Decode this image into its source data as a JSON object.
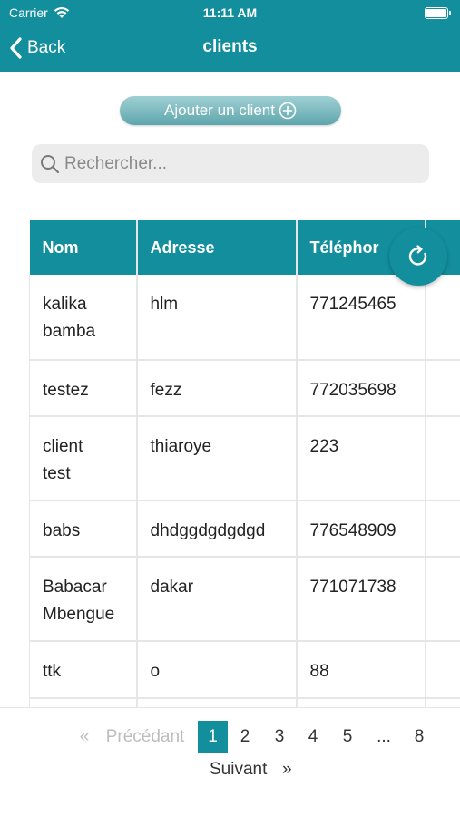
{
  "status_bar": {
    "carrier": "Carrier",
    "time": "11:11 AM"
  },
  "nav": {
    "back_label": "Back",
    "title": "clients"
  },
  "add_button": {
    "label": "Ajouter un client"
  },
  "search": {
    "placeholder": "Rechercher..."
  },
  "table": {
    "headers": [
      "Nom",
      "Adresse",
      "Téléphor",
      ""
    ],
    "rows": [
      {
        "nom": [
          "kalika",
          "bamba"
        ],
        "adresse": "hlm",
        "telephone": "771245465"
      },
      {
        "nom": [
          "testez"
        ],
        "adresse": "fezz",
        "telephone": "772035698"
      },
      {
        "nom": [
          "client",
          "test"
        ],
        "adresse": "thiaroye",
        "telephone": "223"
      },
      {
        "nom": [
          "babs"
        ],
        "adresse": "dhdggdgdgdgd",
        "telephone": "776548909"
      },
      {
        "nom": [
          "Babacar",
          "Mbengue"
        ],
        "adresse": "dakar",
        "telephone": "771071738"
      },
      {
        "nom": [
          "ttk"
        ],
        "adresse": "o",
        "telephone": "88"
      }
    ]
  },
  "pagination": {
    "first": "«",
    "previous": "Précédant",
    "pages": [
      "1",
      "2",
      "3",
      "4",
      "5",
      "...",
      "8"
    ],
    "current_page": "1",
    "next": "Suivant",
    "last": "»"
  },
  "colors": {
    "accent": "#138e9c",
    "add_button": "#6fb3b8"
  },
  "icons": [
    "wifi-icon",
    "battery-icon",
    "chevron-left-icon",
    "plus-circle-icon",
    "search-icon",
    "refresh-icon"
  ]
}
